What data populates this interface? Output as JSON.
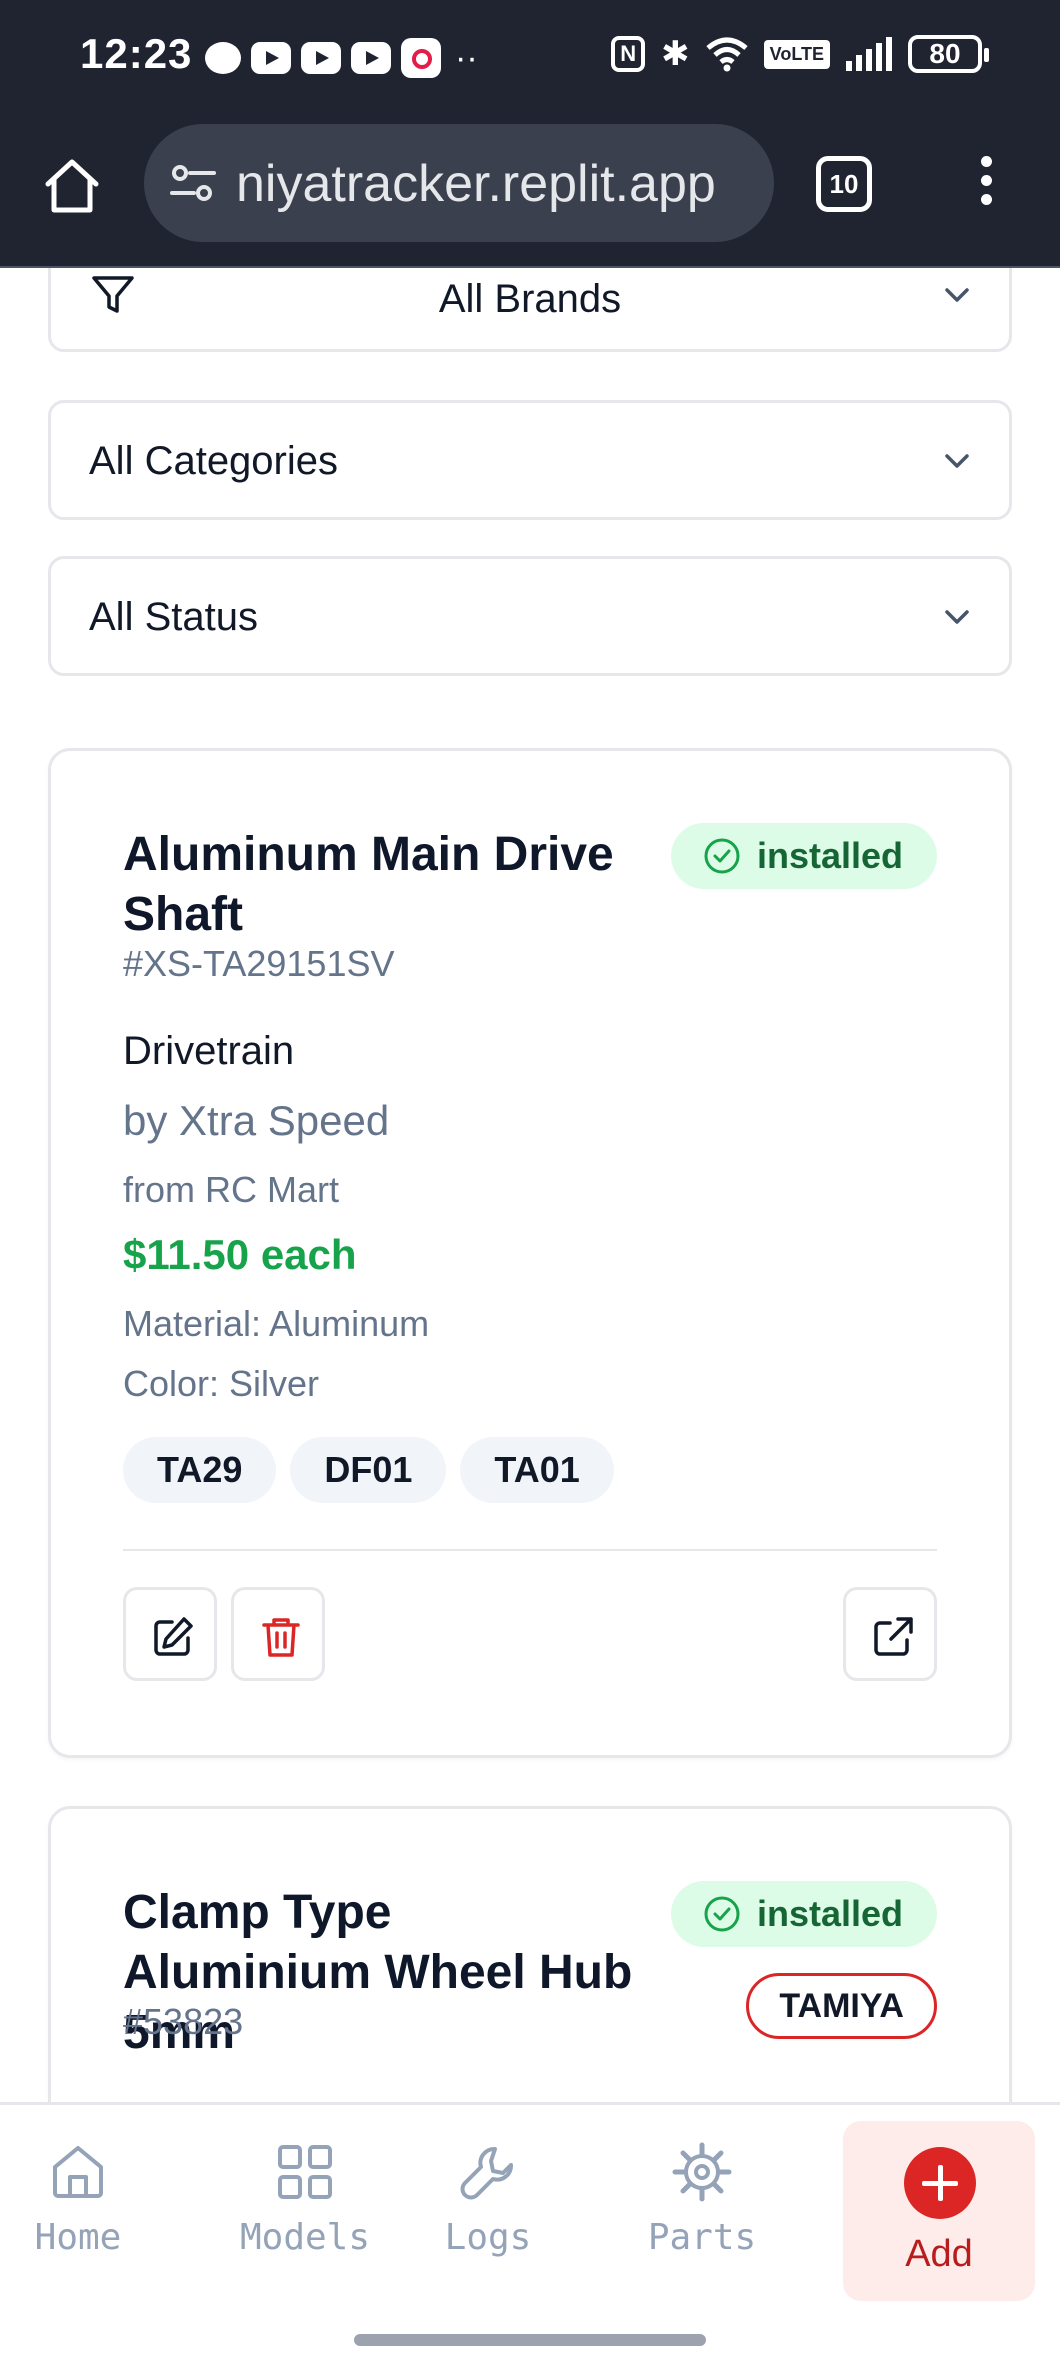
{
  "status_bar": {
    "time": "12:23",
    "battery": "80",
    "volte": "VoLTE"
  },
  "browser": {
    "url": "niyatracker.replit.app",
    "tab_count": "10"
  },
  "filters": {
    "brands": "All Brands",
    "categories": "All Categories",
    "status": "All Status"
  },
  "parts": [
    {
      "name": "Aluminum Main Drive Shaft",
      "sku": "#XS-TA29151SV",
      "status": "installed",
      "category": "Drivetrain",
      "brand": "by Xtra Speed",
      "store": "from RC Mart",
      "price": "$11.50 each",
      "material": "Material: Aluminum",
      "color": "Color: Silver",
      "compatible": [
        "TA29",
        "DF01",
        "TA01"
      ]
    },
    {
      "name": "Clamp Type Aluminium Wheel Hub 5mm",
      "sku": "#53823",
      "status": "installed",
      "brand_badge": "TAMIYA"
    }
  ],
  "nav": {
    "home": "Home",
    "models": "Models",
    "logs": "Logs",
    "parts": "Parts",
    "add": "Add"
  },
  "colors": {
    "accent": "#dc2626",
    "installed_bg": "#dcfce7",
    "installed_text": "#166534",
    "price": "#16a34a",
    "browser_bg": "#1f2430"
  }
}
